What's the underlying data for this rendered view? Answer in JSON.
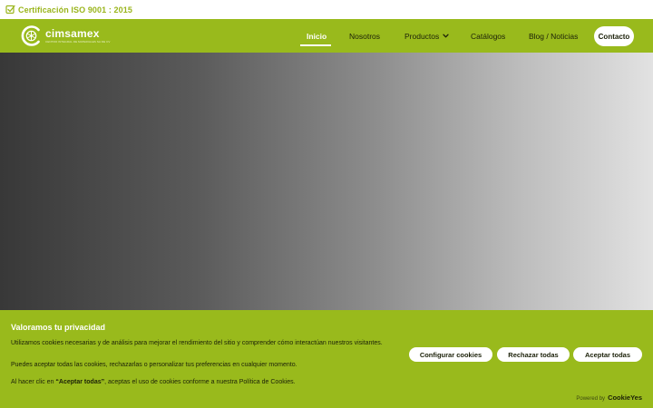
{
  "topbar": {
    "check_icon": "checkbox-icon",
    "certification": "Certificación ISO 9001 : 2015"
  },
  "header": {
    "logo_name": "cimsamex",
    "logo_tagline": "CENTRO INTEGRAL DE MATERIALES SA DE CV",
    "menu": {
      "inicio": "Inicio",
      "nosotros": "Nosotros",
      "productos": "Productos",
      "catalogos": "Catálogos",
      "blog": "Blog / Noticias"
    },
    "contact_label": "Contacto"
  },
  "cookie_banner": {
    "title": "Valoramos tu privacidad",
    "paragraph1": "Utilizamos cookies necesarias y de análisis para mejorar el rendimiento del sitio y comprender cómo interactúan nuestros visitantes.",
    "paragraph2": "Puedes aceptar todas las cookies, rechazarlas o personalizar tus preferencias en cualquier momento.",
    "paragraph3_pre": "Al hacer clic en ",
    "paragraph3_bold": "“Aceptar todas”",
    "paragraph3_post": ", aceptas el uso de cookies conforme a nuestra Política de Cookies.",
    "configure_label": "Configurar cookies",
    "reject_label": "Rechazar todas",
    "accept_label": "Aceptar todas",
    "powered_by": "Powered by",
    "brand": "CookieYes"
  },
  "colors": {
    "brand_green": "#99ba1c",
    "certification_green": "#9ab51c",
    "white": "#ffffff",
    "dark_text": "#1b2008"
  }
}
